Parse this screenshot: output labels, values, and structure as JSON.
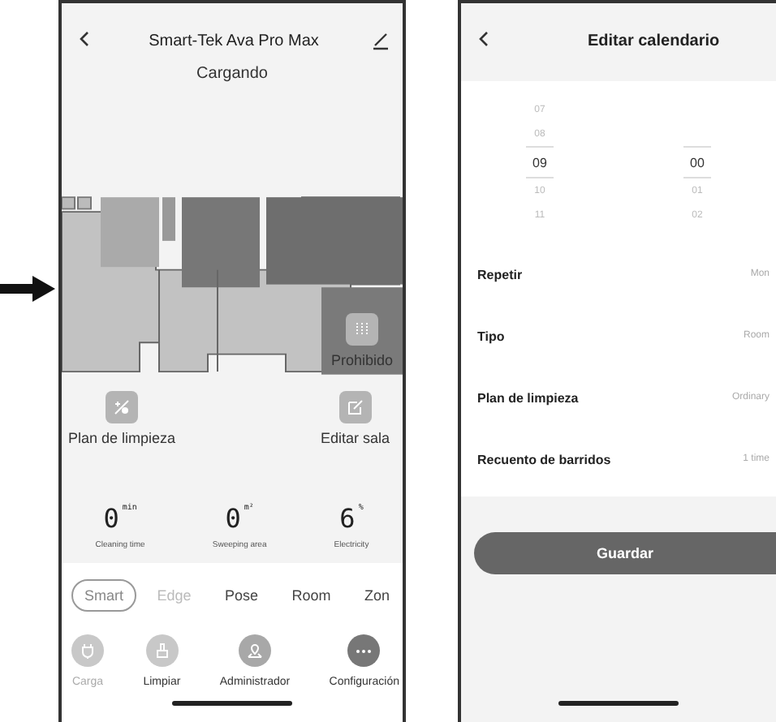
{
  "left_screen": {
    "title": "Smart-Tek Ava Pro Max",
    "status": "Cargando",
    "map_actions": [
      {
        "kind": "forbidden",
        "label": "Prohibido"
      },
      {
        "kind": "edit",
        "label": "Editar sala"
      }
    ],
    "plan_button": {
      "label": "Plan de limpieza"
    },
    "stats": [
      {
        "value": "0",
        "unit": "min",
        "label": "Cleaning time"
      },
      {
        "value": "0",
        "unit": "m²",
        "label": "Sweeping area"
      },
      {
        "value": "6",
        "unit": "%",
        "label": "Electricity"
      }
    ],
    "modes": [
      {
        "label": "Smart",
        "selected": true,
        "disabled": false
      },
      {
        "label": "Edge",
        "selected": false,
        "disabled": true
      },
      {
        "label": "Pose",
        "selected": false,
        "disabled": false
      },
      {
        "label": "Room",
        "selected": false,
        "disabled": false
      },
      {
        "label": "Zon",
        "selected": false,
        "disabled": false
      }
    ],
    "actions": [
      {
        "kind": "plug",
        "label": "Carga",
        "disabled": true
      },
      {
        "kind": "brush",
        "label": "Limpiar",
        "disabled": false
      },
      {
        "kind": "pin",
        "label": "Administrador",
        "disabled": false
      },
      {
        "kind": "more",
        "label": "Configuración",
        "disabled": false
      }
    ]
  },
  "right_screen": {
    "title": "Editar calendario",
    "hours": [
      {
        "label": "07",
        "selected": false
      },
      {
        "label": "08",
        "selected": false
      },
      {
        "label": "09",
        "selected": true
      },
      {
        "label": "10",
        "selected": false
      },
      {
        "label": "11",
        "selected": false
      }
    ],
    "minutes": [
      {
        "label": "00",
        "selected": true
      },
      {
        "label": "01",
        "selected": false
      },
      {
        "label": "02",
        "selected": false
      }
    ],
    "settings": [
      {
        "label": "Repetir",
        "value": "Mon"
      },
      {
        "label": "Tipo",
        "value": "Room"
      },
      {
        "label": "Plan de limpieza",
        "value": "Ordinary"
      },
      {
        "label": "Recuento de barridos",
        "value": "1 time"
      }
    ],
    "save_button": "Guardar"
  }
}
